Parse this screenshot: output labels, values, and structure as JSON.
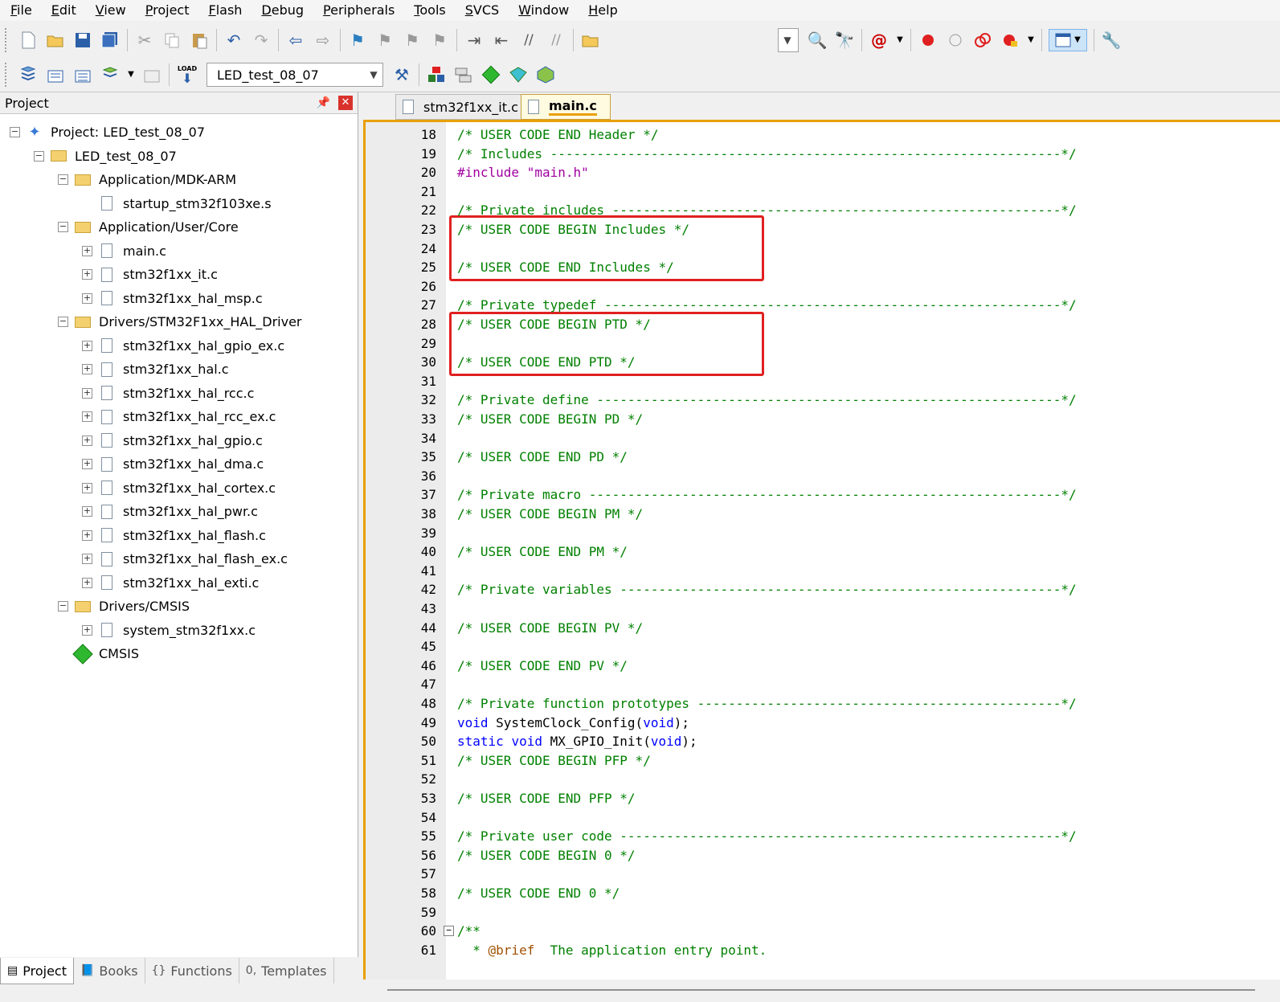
{
  "menu": [
    "File",
    "Edit",
    "View",
    "Project",
    "Flash",
    "Debug",
    "Peripherals",
    "Tools",
    "SVCS",
    "Window",
    "Help"
  ],
  "toolbar2": {
    "target_combo": "LED_test_08_07",
    "load_label": "LOAD"
  },
  "project_panel": {
    "title": "Project",
    "tree": [
      {
        "label": "Project: LED_test_08_07",
        "type": "project",
        "level": 0,
        "expander": "minus"
      },
      {
        "label": "LED_test_08_07",
        "type": "target",
        "level": 1,
        "expander": "minus"
      },
      {
        "label": "Application/MDK-ARM",
        "type": "folder",
        "level": 2,
        "expander": "minus"
      },
      {
        "label": "startup_stm32f103xe.s",
        "type": "file",
        "level": 3,
        "expander": "none"
      },
      {
        "label": "Application/User/Core",
        "type": "folder",
        "level": 2,
        "expander": "minus"
      },
      {
        "label": "main.c",
        "type": "file",
        "level": 3,
        "expander": "plus"
      },
      {
        "label": "stm32f1xx_it.c",
        "type": "file",
        "level": 3,
        "expander": "plus"
      },
      {
        "label": "stm32f1xx_hal_msp.c",
        "type": "file",
        "level": 3,
        "expander": "plus"
      },
      {
        "label": "Drivers/STM32F1xx_HAL_Driver",
        "type": "folder",
        "level": 2,
        "expander": "minus"
      },
      {
        "label": "stm32f1xx_hal_gpio_ex.c",
        "type": "file",
        "level": 3,
        "expander": "plus"
      },
      {
        "label": "stm32f1xx_hal.c",
        "type": "file",
        "level": 3,
        "expander": "plus"
      },
      {
        "label": "stm32f1xx_hal_rcc.c",
        "type": "file",
        "level": 3,
        "expander": "plus"
      },
      {
        "label": "stm32f1xx_hal_rcc_ex.c",
        "type": "file",
        "level": 3,
        "expander": "plus"
      },
      {
        "label": "stm32f1xx_hal_gpio.c",
        "type": "file",
        "level": 3,
        "expander": "plus"
      },
      {
        "label": "stm32f1xx_hal_dma.c",
        "type": "file",
        "level": 3,
        "expander": "plus"
      },
      {
        "label": "stm32f1xx_hal_cortex.c",
        "type": "file",
        "level": 3,
        "expander": "plus"
      },
      {
        "label": "stm32f1xx_hal_pwr.c",
        "type": "file",
        "level": 3,
        "expander": "plus"
      },
      {
        "label": "stm32f1xx_hal_flash.c",
        "type": "file",
        "level": 3,
        "expander": "plus"
      },
      {
        "label": "stm32f1xx_hal_flash_ex.c",
        "type": "file",
        "level": 3,
        "expander": "plus"
      },
      {
        "label": "stm32f1xx_hal_exti.c",
        "type": "file",
        "level": 3,
        "expander": "plus"
      },
      {
        "label": "Drivers/CMSIS",
        "type": "folder",
        "level": 2,
        "expander": "minus"
      },
      {
        "label": "system_stm32f1xx.c",
        "type": "file",
        "level": 3,
        "expander": "plus"
      },
      {
        "label": "CMSIS",
        "type": "cmsis",
        "level": 2,
        "expander": "none"
      }
    ],
    "bottom_tabs": [
      {
        "label": "Project",
        "icon": "project-tab-icon",
        "active": true
      },
      {
        "label": "Books",
        "icon": "books-icon",
        "active": false
      },
      {
        "label": "Functions",
        "icon": "functions-icon",
        "active": false
      },
      {
        "label": "Templates",
        "icon": "templates-icon",
        "active": false
      }
    ]
  },
  "editor": {
    "tabs": [
      {
        "label": "stm32f1xx_it.c",
        "active": false
      },
      {
        "label": "main.c",
        "active": true
      }
    ],
    "lines": [
      {
        "n": "18",
        "text": "/* USER CODE END Header */",
        "kind": "comment"
      },
      {
        "n": "19",
        "text": "/* Includes ------------------------------------------------------------------*/",
        "kind": "comment"
      },
      {
        "n": "20",
        "text": "#include \"main.h\"",
        "kind": "include"
      },
      {
        "n": "21",
        "text": "",
        "kind": "blank"
      },
      {
        "n": "22",
        "text": "/* Private includes ----------------------------------------------------------*/",
        "kind": "comment"
      },
      {
        "n": "23",
        "text": "/* USER CODE BEGIN Includes */",
        "kind": "comment"
      },
      {
        "n": "24",
        "text": "",
        "kind": "blank"
      },
      {
        "n": "25",
        "text": "/* USER CODE END Includes */",
        "kind": "comment"
      },
      {
        "n": "26",
        "text": "",
        "kind": "blank"
      },
      {
        "n": "27",
        "text": "/* Private typedef -----------------------------------------------------------*/",
        "kind": "comment"
      },
      {
        "n": "28",
        "text": "/* USER CODE BEGIN PTD */",
        "kind": "comment"
      },
      {
        "n": "29",
        "text": "",
        "kind": "blank"
      },
      {
        "n": "30",
        "text": "/* USER CODE END PTD */",
        "kind": "comment"
      },
      {
        "n": "31",
        "text": "",
        "kind": "blank"
      },
      {
        "n": "32",
        "text": "/* Private define ------------------------------------------------------------*/",
        "kind": "comment"
      },
      {
        "n": "33",
        "text": "/* USER CODE BEGIN PD */",
        "kind": "comment"
      },
      {
        "n": "34",
        "text": "",
        "kind": "blank"
      },
      {
        "n": "35",
        "text": "/* USER CODE END PD */",
        "kind": "comment"
      },
      {
        "n": "36",
        "text": "",
        "kind": "blank"
      },
      {
        "n": "37",
        "text": "/* Private macro -------------------------------------------------------------*/",
        "kind": "comment"
      },
      {
        "n": "38",
        "text": "/* USER CODE BEGIN PM */",
        "kind": "comment"
      },
      {
        "n": "39",
        "text": "",
        "kind": "blank"
      },
      {
        "n": "40",
        "text": "/* USER CODE END PM */",
        "kind": "comment"
      },
      {
        "n": "41",
        "text": "",
        "kind": "blank"
      },
      {
        "n": "42",
        "text": "/* Private variables ---------------------------------------------------------*/",
        "kind": "comment"
      },
      {
        "n": "43",
        "text": "",
        "kind": "blank"
      },
      {
        "n": "44",
        "text": "/* USER CODE BEGIN PV */",
        "kind": "comment"
      },
      {
        "n": "45",
        "text": "",
        "kind": "blank"
      },
      {
        "n": "46",
        "text": "/* USER CODE END PV */",
        "kind": "comment"
      },
      {
        "n": "47",
        "text": "",
        "kind": "blank"
      },
      {
        "n": "48",
        "text": "/* Private function prototypes -----------------------------------------------*/",
        "kind": "comment"
      },
      {
        "n": "49",
        "text": "void SystemClock_Config(void);",
        "kind": "code1"
      },
      {
        "n": "50",
        "text": "static void MX_GPIO_Init(void);",
        "kind": "code2"
      },
      {
        "n": "51",
        "text": "/* USER CODE BEGIN PFP */",
        "kind": "comment"
      },
      {
        "n": "52",
        "text": "",
        "kind": "blank"
      },
      {
        "n": "53",
        "text": "/* USER CODE END PFP */",
        "kind": "comment"
      },
      {
        "n": "54",
        "text": "",
        "kind": "blank"
      },
      {
        "n": "55",
        "text": "/* Private user code ---------------------------------------------------------*/",
        "kind": "comment"
      },
      {
        "n": "56",
        "text": "/* USER CODE BEGIN 0 */",
        "kind": "comment"
      },
      {
        "n": "57",
        "text": "",
        "kind": "blank"
      },
      {
        "n": "58",
        "text": "/* USER CODE END 0 */",
        "kind": "comment"
      },
      {
        "n": "59",
        "text": "",
        "kind": "blank"
      },
      {
        "n": "60",
        "text": "/**",
        "kind": "comment",
        "fold": true
      },
      {
        "n": "61",
        "text": "  * @brief  The application entry point.",
        "kind": "doc"
      }
    ],
    "highlight_color": "#e02020",
    "comment_color": "#008000",
    "keyword_color": "#0000ff"
  }
}
